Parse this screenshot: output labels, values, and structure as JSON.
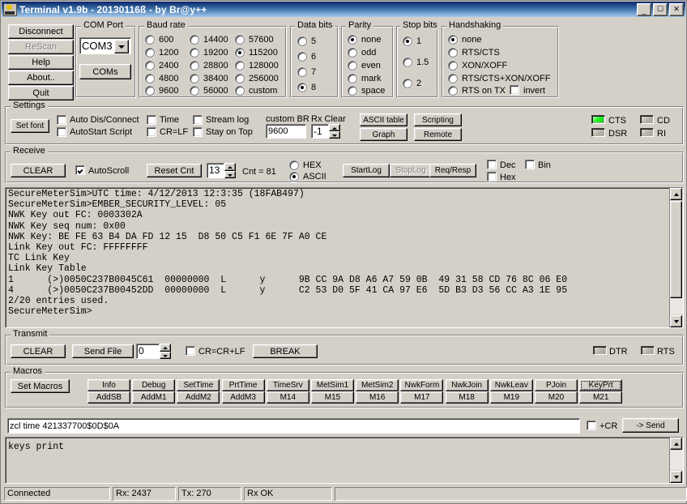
{
  "window": {
    "title": "Terminal v1.9b - 20130116ß - by Br@y++",
    "minimize": "_",
    "maximize": "□",
    "close": "✕"
  },
  "left_buttons": [
    {
      "label": "Disconnect",
      "name": "disconnect-button",
      "disabled": false
    },
    {
      "label": "ReScan",
      "name": "rescan-button",
      "disabled": true
    },
    {
      "label": "Help",
      "name": "help-button",
      "disabled": false
    },
    {
      "label": "About..",
      "name": "about-button",
      "disabled": false
    },
    {
      "label": "Quit",
      "name": "quit-button",
      "disabled": false
    }
  ],
  "com_port": {
    "title": "COM Port",
    "selected": "COM3",
    "coms_button": "COMs"
  },
  "baud_rate": {
    "title": "Baud rate",
    "selected": "115200",
    "col1": [
      "600",
      "1200",
      "2400",
      "4800",
      "9600"
    ],
    "col2": [
      "14400",
      "19200",
      "28800",
      "38400",
      "56000"
    ],
    "col3": [
      "57600",
      "115200",
      "128000",
      "256000",
      "custom"
    ]
  },
  "data_bits": {
    "title": "Data bits",
    "selected": "8",
    "options": [
      "5",
      "6",
      "7",
      "8"
    ]
  },
  "parity": {
    "title": "Parity",
    "selected": "none",
    "options": [
      "none",
      "odd",
      "even",
      "mark",
      "space"
    ]
  },
  "stop_bits": {
    "title": "Stop bits",
    "selected": "1",
    "options": [
      "1",
      "1.5",
      "2"
    ]
  },
  "handshaking": {
    "title": "Handshaking",
    "selected": "none",
    "options": [
      "none",
      "RTS/CTS",
      "XON/XOFF",
      "RTS/CTS+XON/XOFF",
      "RTS on TX"
    ],
    "invert_label": "invert",
    "invert_checked": false
  },
  "settings": {
    "title": "Settings",
    "set_font": "Set font",
    "checks": [
      {
        "label": "Auto Dis/Connect",
        "checked": false,
        "name": "auto-dis-connect-checkbox"
      },
      {
        "label": "AutoStart Script",
        "checked": false,
        "name": "autostart-script-checkbox"
      },
      {
        "label": "Time",
        "checked": false,
        "name": "time-checkbox"
      },
      {
        "label": "CR=LF",
        "checked": false,
        "name": "cr-eq-lf-checkbox"
      },
      {
        "label": "Stream log",
        "checked": false,
        "name": "stream-log-checkbox"
      },
      {
        "label": "Stay on Top",
        "checked": false,
        "name": "stay-on-top-checkbox"
      }
    ],
    "custom_br_label": "custom BR",
    "custom_br_value": "9600",
    "rx_clear_label": "Rx Clear",
    "rx_clear_value": "-1",
    "ascii_table": "ASCII table",
    "scripting": "Scripting",
    "graph": "Graph",
    "remote": "Remote",
    "leds": [
      {
        "label": "CTS",
        "on": true,
        "name": "cts-led"
      },
      {
        "label": "CD",
        "on": false,
        "name": "cd-led"
      },
      {
        "label": "DSR",
        "on": false,
        "name": "dsr-led"
      },
      {
        "label": "RI",
        "on": false,
        "name": "ri-led"
      }
    ]
  },
  "receive": {
    "title": "Receive",
    "clear": "CLEAR",
    "autoscroll_label": "AutoScroll",
    "autoscroll_checked": true,
    "reset_cnt": "Reset Cnt",
    "cnt_spin_value": "13",
    "cnt_label": "Cnt = 81",
    "hex_label": "HEX",
    "ascii_label": "ASCII",
    "format_selected": "ASCII",
    "startlog": "StartLog",
    "stoplog": "StopLog",
    "req_resp": "Req/Resp",
    "dec_label": "Dec",
    "hex2_label": "Hex",
    "bin_label": "Bin",
    "dec_checked": false,
    "hex2_checked": false,
    "bin_checked": false
  },
  "terminal": {
    "lines": [
      "SecureMeterSim>UTC time: 4/12/2013 12:3:35 (18FAB497)",
      "SecureMeterSim>EMBER_SECURITY_LEVEL: 05",
      "NWK Key out FC: 0003302A",
      "NWK Key seq num: 0x00",
      "NWK Key: BE FE 63 B4 DA FD 12 15  D8 50 C5 F1 6E 7F A0 CE",
      "Link Key out FC: FFFFFFFF",
      "TC Link Key",
      "Link Key Table",
      "1      (>)0050C237B0045C61  00000000  L      y      9B CC 9A D8 A6 A7 59 0B  49 31 58 CD 76 8C 06 E0",
      "4      (>)0050C237B00452DD  00000000  L      y      C2 53 D0 5F 41 CA 97 E6  5D B3 D3 56 CC A3 1E 95",
      "2/20 entries used.",
      "SecureMeterSim>"
    ]
  },
  "transmit": {
    "title": "Transmit",
    "clear": "CLEAR",
    "send_file": "Send File",
    "spin_value": "0",
    "cr_eq_cr_lf_label": "CR=CR+LF",
    "cr_eq_cr_lf_checked": false,
    "break": "BREAK",
    "leds": [
      {
        "label": "DTR",
        "on": false,
        "name": "dtr-led"
      },
      {
        "label": "RTS",
        "on": false,
        "name": "rts-led"
      }
    ]
  },
  "macros": {
    "title": "Macros",
    "set_macros": "Set Macros",
    "row1": [
      "Info",
      "Debug",
      "SetTime",
      "PrtTime",
      "TimeSrv",
      "MetSim1",
      "MetSim2",
      "NwkForm",
      "NwkJoin",
      "NwkLeav",
      "PJoin",
      "KeyPrt"
    ],
    "row2": [
      "AddSB",
      "AddM1",
      "AddM2",
      "AddM3",
      "M14",
      "M15",
      "M16",
      "M17",
      "M18",
      "M19",
      "M20",
      "M21"
    ],
    "focused": "KeyPrt"
  },
  "send": {
    "value": "zcl time 421337700$0D$0A",
    "plus_cr_label": "+CR",
    "plus_cr_checked": false,
    "send_button": "-> Send"
  },
  "send_history": {
    "lines": [
      "keys print"
    ]
  },
  "statusbar": {
    "panels": [
      "Connected",
      "Rx: 2437",
      "Tx: 270",
      "Rx OK",
      ""
    ]
  }
}
